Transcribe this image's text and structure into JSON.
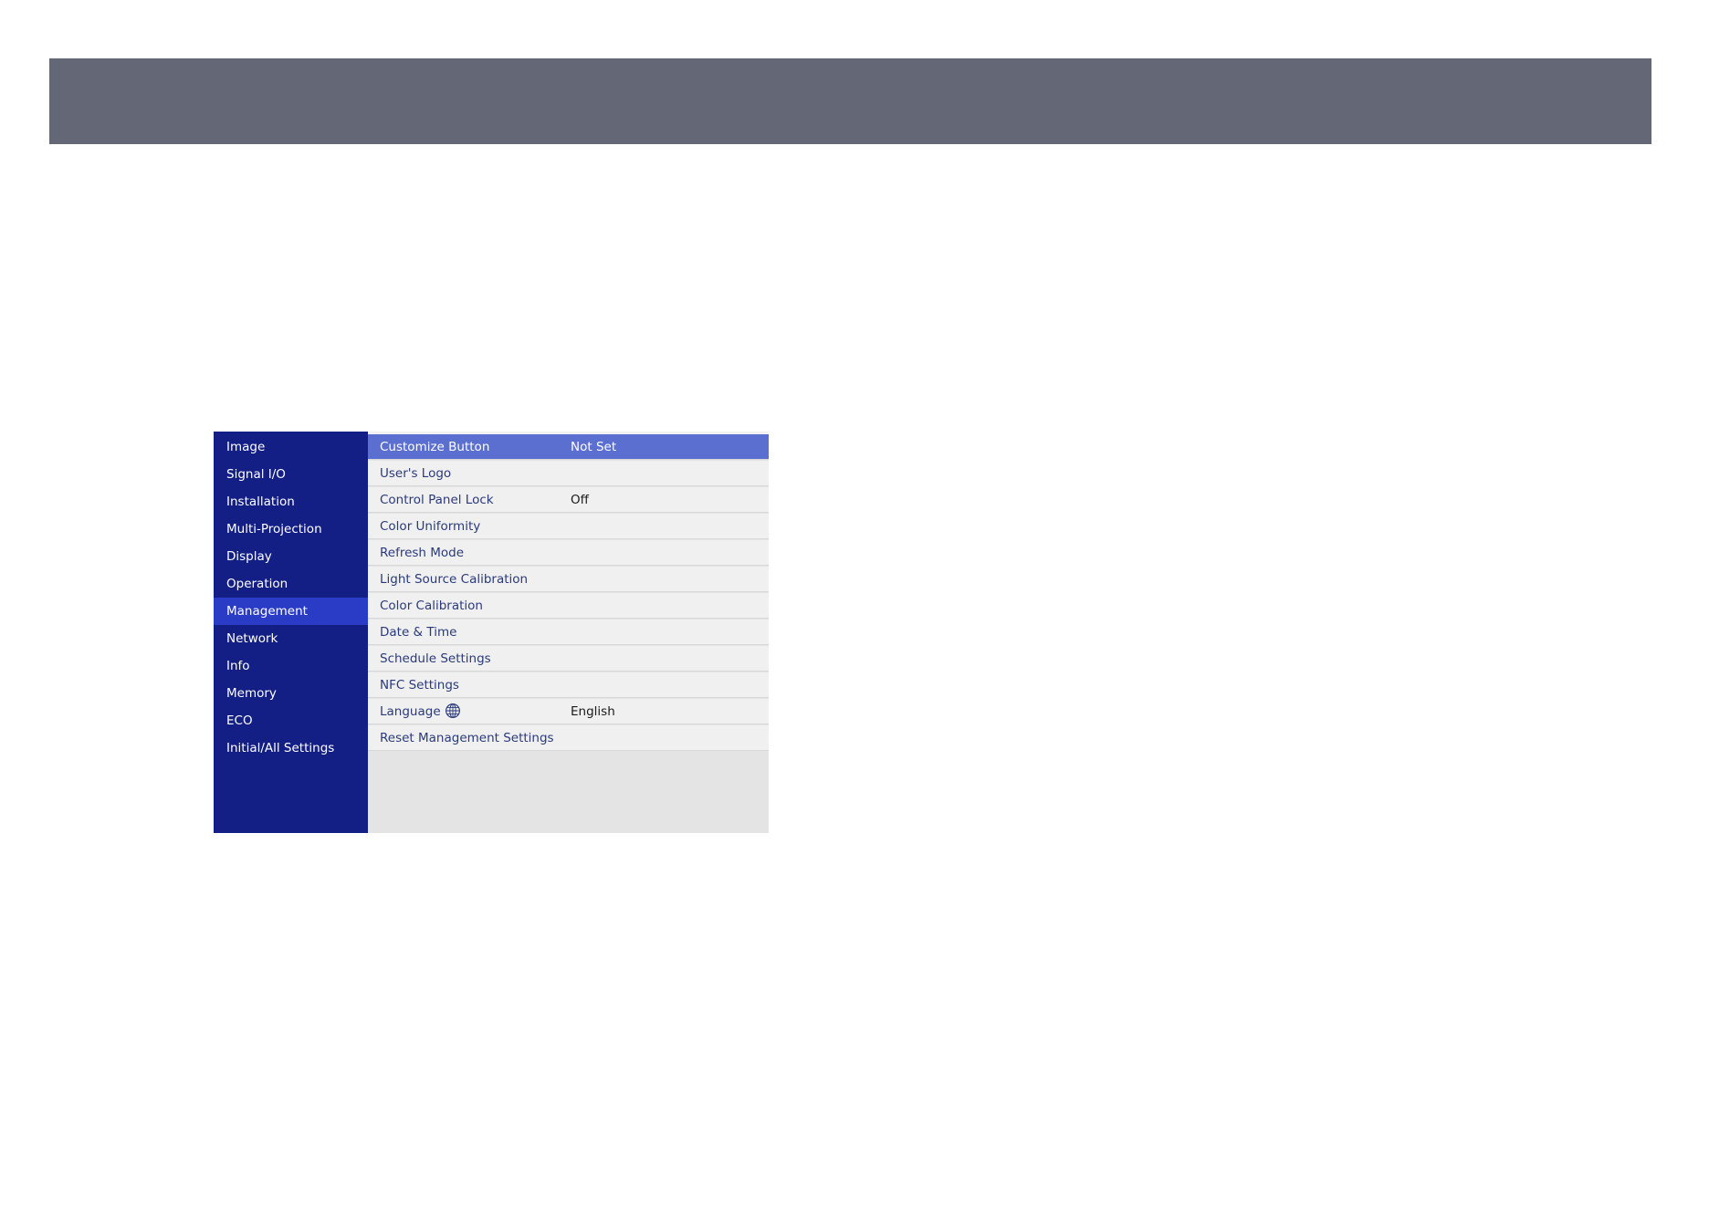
{
  "colors": {
    "header_bar": "#646775",
    "sidebar_bg": "#131f85",
    "sidebar_selected_bg": "#2a3bc6",
    "sidebar_text": "#ffffff",
    "panel_row_bg": "#f0f0f0",
    "panel_selected_bg": "#5b6fd0",
    "panel_label_text": "#2a3a7a",
    "panel_value_text": "#1a1a1a",
    "panel_selected_text": "#ffffff",
    "panel_empty_bg": "#e4e4e4"
  },
  "sidebar": {
    "selected_index": 6,
    "items": [
      {
        "label": "Image"
      },
      {
        "label": "Signal I/O"
      },
      {
        "label": "Installation"
      },
      {
        "label": "Multi-Projection"
      },
      {
        "label": "Display"
      },
      {
        "label": "Operation"
      },
      {
        "label": "Management"
      },
      {
        "label": "Network"
      },
      {
        "label": "Info"
      },
      {
        "label": "Memory"
      },
      {
        "label": "ECO"
      },
      {
        "label": "Initial/All Settings"
      }
    ]
  },
  "panel": {
    "selected_index": 0,
    "rows": [
      {
        "label": "Customize Button",
        "value": "Not Set"
      },
      {
        "label": "User's Logo",
        "value": ""
      },
      {
        "label": "Control Panel Lock",
        "value": "Off"
      },
      {
        "label": "Color Uniformity",
        "value": ""
      },
      {
        "label": "Refresh Mode",
        "value": ""
      },
      {
        "label": "Light Source Calibration",
        "value": ""
      },
      {
        "label": "Color Calibration",
        "value": ""
      },
      {
        "label": "Date & Time",
        "value": ""
      },
      {
        "label": "Schedule Settings",
        "value": ""
      },
      {
        "label": "NFC Settings",
        "value": ""
      },
      {
        "label": "Language",
        "value": "English",
        "icon": "globe-icon"
      },
      {
        "label": "Reset Management Settings",
        "value": ""
      }
    ]
  }
}
